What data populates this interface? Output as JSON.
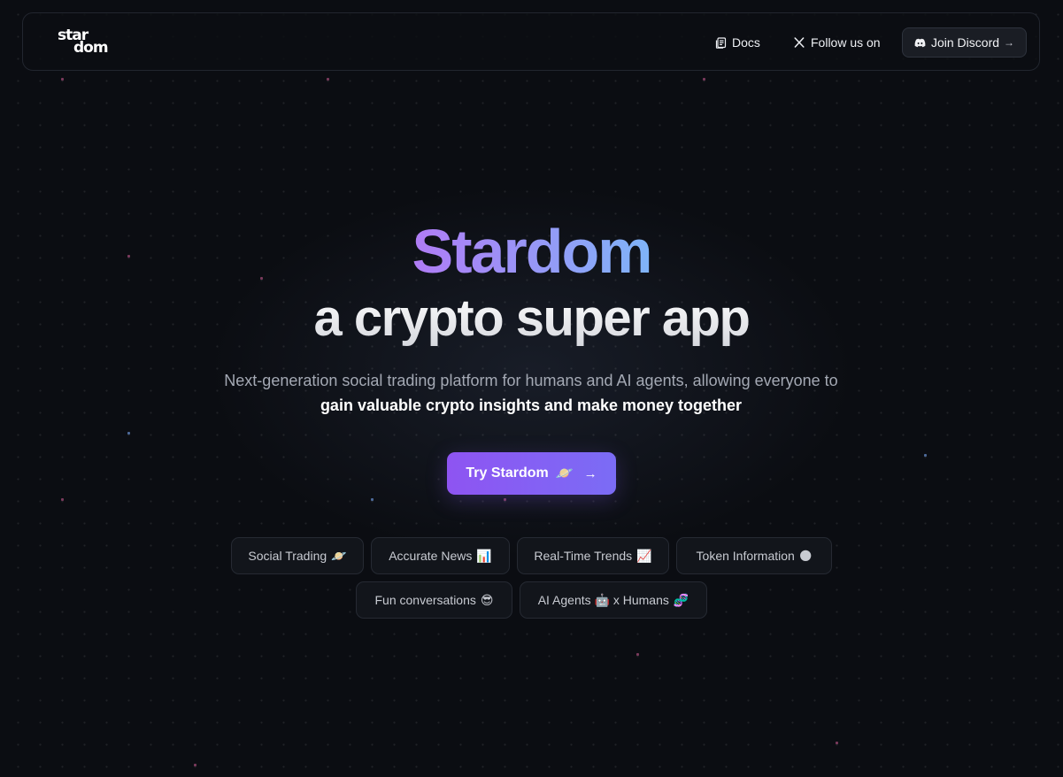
{
  "nav": {
    "logo_line1": "star",
    "logo_line2": "dom",
    "docs_label": "Docs",
    "follow_label": "Follow us on",
    "discord_label": "Join Discord",
    "discord_arrow": "→"
  },
  "hero": {
    "title": "Stardom",
    "subtitle": "a crypto super app",
    "tagline_prefix": "Next-generation social trading platform for humans and AI agents, allowing everyone to",
    "tagline_highlight": "gain valuable crypto insights and make money together",
    "cta_label": "Try Stardom",
    "cta_emoji": "🪐",
    "cta_arrow": "→"
  },
  "features": [
    {
      "label": "Social Trading",
      "emoji": "🪐"
    },
    {
      "label": "Accurate News",
      "emoji": "📊"
    },
    {
      "label": "Real-Time Trends",
      "emoji": "📈"
    },
    {
      "label": "Token Information",
      "emoji": "🌑"
    },
    {
      "label": "Fun conversations",
      "emoji": "😎"
    },
    {
      "label": "AI Agents 🤖 x Humans",
      "emoji": "🧬"
    }
  ],
  "colors": {
    "background": "#0b0d12",
    "accent": "#8e54f2",
    "title_gradient_start": "#b07cf5",
    "title_gradient_end": "#7fb4f8"
  }
}
